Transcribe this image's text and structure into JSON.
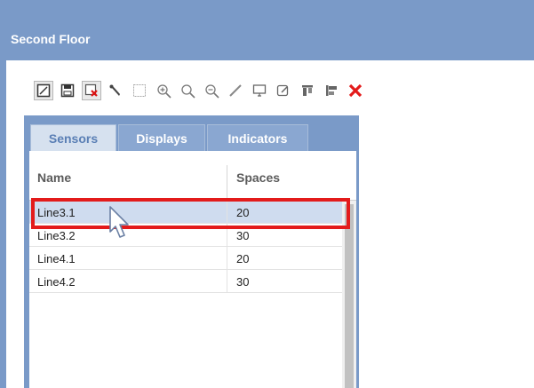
{
  "window": {
    "title": "Second Floor"
  },
  "toolbar": {
    "buttons": [
      "edit-icon",
      "save-icon",
      "delete-icon",
      "wrench-icon",
      "select-area-icon",
      "zoom-in-icon",
      "zoom-reset-icon",
      "zoom-out-icon",
      "line-icon",
      "display-icon",
      "edit-note-icon",
      "align-top-icon",
      "align-left-icon",
      "close-icon"
    ]
  },
  "tabs": [
    {
      "label": "Sensors",
      "active": true
    },
    {
      "label": "Displays",
      "active": false
    },
    {
      "label": "Indicators",
      "active": false
    }
  ],
  "table": {
    "columns": [
      "Name",
      "Spaces"
    ],
    "rows": [
      {
        "name": "Line3.1",
        "spaces": "20",
        "selected": true
      },
      {
        "name": "Line3.2",
        "spaces": "30",
        "selected": false
      },
      {
        "name": "Line4.1",
        "spaces": "20",
        "selected": false
      },
      {
        "name": "Line4.2",
        "spaces": "30",
        "selected": false
      }
    ]
  },
  "colors": {
    "titlebar": "#7a9ac8",
    "selection": "#cfdcef",
    "highlight": "#e31b1b",
    "delete": "#e31b1b"
  }
}
